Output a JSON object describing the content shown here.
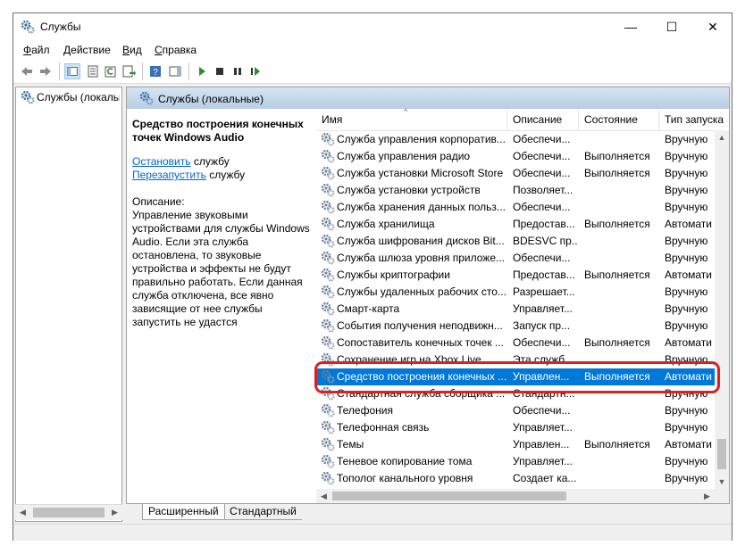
{
  "window": {
    "title": "Службы",
    "minimize": "—",
    "maximize": "☐",
    "close": "✕"
  },
  "menu": [
    {
      "label": "Файл",
      "key": "Ф",
      "rest": "айл"
    },
    {
      "label": "Действие",
      "key": "Д",
      "rest": "ействие"
    },
    {
      "label": "Вид",
      "key": "В",
      "rest": "ид"
    },
    {
      "label": "Справка",
      "key": "С",
      "rest": "правка"
    }
  ],
  "tree": {
    "root_label": "Службы (локальные)"
  },
  "panel": {
    "title": "Службы (локальные)"
  },
  "details": {
    "service_title": "Средство построения конечных точек Windows Audio",
    "stop_link": "Остановить",
    "stop_suffix": " службу",
    "restart_link": "Перезапустить",
    "restart_suffix": " службу",
    "description_label": "Описание:",
    "description": "Управление звуковыми устройствами для службы Windows Audio.  Если эта служба остановлена, то звуковые устройства и эффекты не будут правильно работать.  Если данная служба отключена, все явно зависящие от нее службы запустить не удастся"
  },
  "columns": {
    "name": "Имя",
    "description": "Описание",
    "status": "Состояние",
    "startup": "Тип запуска"
  },
  "rows": [
    {
      "name": "Служба управления корпоратив...",
      "desc": "Обеспечи...",
      "status": "",
      "startup": "Вручную"
    },
    {
      "name": "Служба управления радио",
      "desc": "Обеспечи...",
      "status": "Выполняется",
      "startup": "Вручную"
    },
    {
      "name": "Служба установки Microsoft Store",
      "desc": "Обеспечи...",
      "status": "Выполняется",
      "startup": "Вручную"
    },
    {
      "name": "Служба установки устройств",
      "desc": "Позволяет...",
      "status": "",
      "startup": "Вручную"
    },
    {
      "name": "Служба хранения данных польз...",
      "desc": "Обеспечи...",
      "status": "",
      "startup": "Вручную"
    },
    {
      "name": "Служба хранилища",
      "desc": "Предостав...",
      "status": "Выполняется",
      "startup": "Автомати"
    },
    {
      "name": "Служба шифрования дисков Bit...",
      "desc": "BDESVC пр...",
      "status": "",
      "startup": "Вручную"
    },
    {
      "name": "Служба шлюза уровня приложе...",
      "desc": "Обеспечи...",
      "status": "",
      "startup": "Вручную"
    },
    {
      "name": "Службы криптографии",
      "desc": "Предостав...",
      "status": "Выполняется",
      "startup": "Автомати"
    },
    {
      "name": "Службы удаленных рабочих сто...",
      "desc": "Разрешает...",
      "status": "",
      "startup": "Вручную"
    },
    {
      "name": "Смарт-карта",
      "desc": "Управляет...",
      "status": "",
      "startup": "Вручную"
    },
    {
      "name": "События получения неподвижн...",
      "desc": "Запуск пр...",
      "status": "",
      "startup": "Вручную"
    },
    {
      "name": "Сопоставитель конечных точек ...",
      "desc": "Обеспечи...",
      "status": "Выполняется",
      "startup": "Автомати"
    },
    {
      "name": "Сохранение игр на Xbox Live",
      "desc": "Эта служб...",
      "status": "",
      "startup": "Вручную"
    },
    {
      "name": "Средство построения конечных ...",
      "desc": "Управлен...",
      "status": "Выполняется",
      "startup": "Автомати",
      "selected": true
    },
    {
      "name": "Стандартная служба сборщика ...",
      "desc": "Стандартн...",
      "status": "",
      "startup": "Вручную"
    },
    {
      "name": "Телефония",
      "desc": "Обеспечи...",
      "status": "",
      "startup": "Вручную"
    },
    {
      "name": "Телефонная связь",
      "desc": "Управляет...",
      "status": "",
      "startup": "Вручную"
    },
    {
      "name": "Темы",
      "desc": "Управлен...",
      "status": "Выполняется",
      "startup": "Автомати"
    },
    {
      "name": "Теневое копирование тома",
      "desc": "Управляет...",
      "status": "",
      "startup": "Вручную"
    },
    {
      "name": "Тополог канального уровня",
      "desc": "Создает ка...",
      "status": "",
      "startup": "Вручную"
    }
  ],
  "tabs": {
    "extended": "Расширенный",
    "standard": "Стандартный"
  },
  "colors": {
    "selection": "#0078d7",
    "highlight_ring": "#e01e1e",
    "link": "#0066cc"
  }
}
